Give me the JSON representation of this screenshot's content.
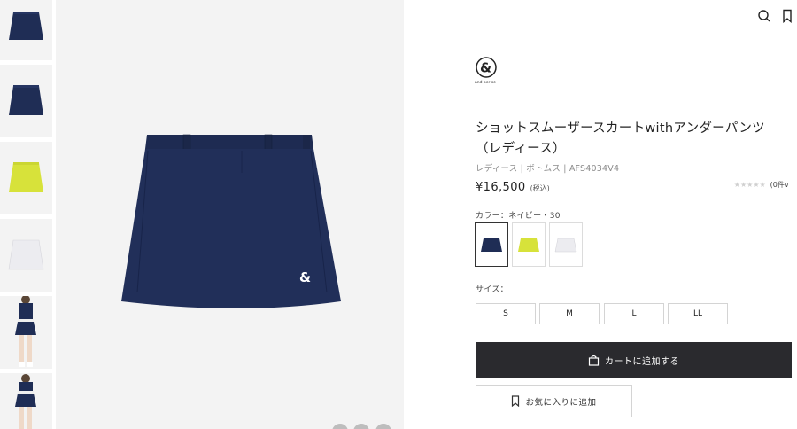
{
  "product": {
    "brand_text": "and per se",
    "title": "ショットスムーザースカートwithアンダーパンツ（レディース）",
    "breadcrumb": "レディース | ボトムス | AFS4034V4",
    "price": "¥16,500",
    "tax_note": "(税込)",
    "review_count": "(0件",
    "review_chevron": "∨",
    "stars": "★★★★★"
  },
  "color": {
    "label": "カラー：ネイビー・30",
    "options": [
      {
        "name": "navy",
        "hex": "#1f2d55"
      },
      {
        "name": "yellow",
        "hex": "#d7e23a"
      },
      {
        "name": "white",
        "hex": "#f4f4f6"
      }
    ]
  },
  "size": {
    "label": "サイズ：",
    "options": [
      "S",
      "M",
      "L",
      "LL"
    ]
  },
  "actions": {
    "cart_label": "カートに追加する",
    "favorite_label": "お気に入りに追加"
  },
  "icons": {
    "search": "search-icon",
    "bookmark": "bookmark-icon",
    "bag": "bag-icon"
  },
  "colors": {
    "navy": "#1f2d55",
    "dark_button": "#2a2a2e",
    "background_gray": "#f3f3f3"
  }
}
